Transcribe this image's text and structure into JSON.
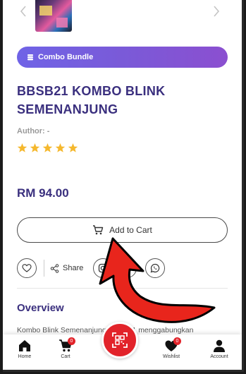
{
  "carousel": {
    "image_alt": "product-thumbnail"
  },
  "badge": {
    "label": "Combo Bundle",
    "color_start": "#6f63e6",
    "color_end": "#8b4fd0"
  },
  "product": {
    "title_line1": "BBSB21 KOMBO BLINK",
    "title_line2": "SEMENANJUNG",
    "author": "Author: -",
    "rating": 5,
    "rating_max": 5,
    "price": "RM 94.00"
  },
  "actions": {
    "add_to_cart": "Add to Cart",
    "share": "Share"
  },
  "overview": {
    "heading": "Overview",
    "description": "Kombo Blink Semenanjung BBSB21 menggabungkan"
  },
  "nav": {
    "home": "Home",
    "cart": "Cart",
    "cart_count": "0",
    "wishlist": "Wishlist",
    "wishlist_count": "0",
    "account": "Account"
  },
  "colors": {
    "brand": "#3a2f7e",
    "accent_red": "#e2232a",
    "star": "#f5b82e"
  }
}
